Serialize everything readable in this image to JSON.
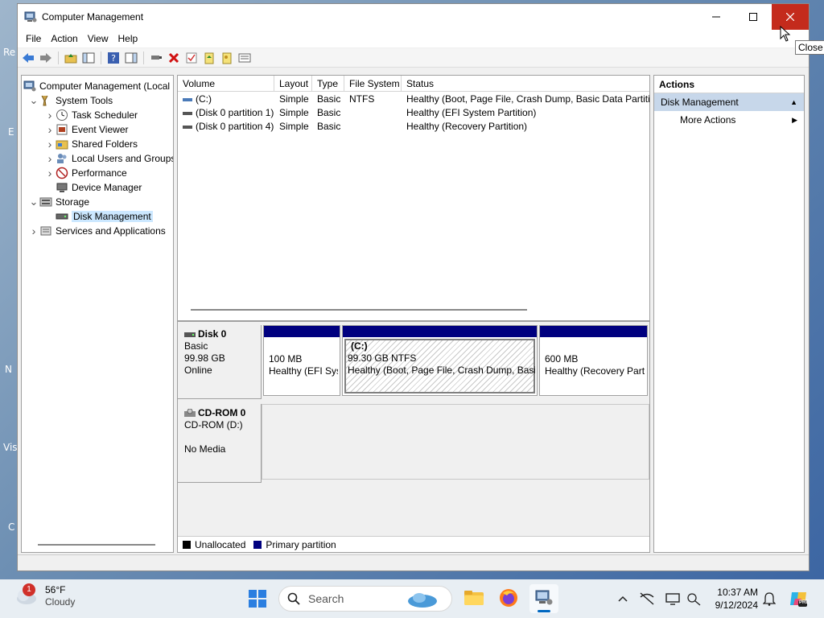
{
  "window": {
    "title": "Computer Management",
    "close_tooltip": "Close"
  },
  "menu": [
    "File",
    "Action",
    "View",
    "Help"
  ],
  "tree": [
    {
      "label": "Computer Management (Local",
      "icon": "computer-management-icon",
      "indent": 0,
      "arrow": ""
    },
    {
      "label": "System Tools",
      "icon": "system-tools-icon",
      "indent": 1,
      "arrow": "expanded"
    },
    {
      "label": "Task Scheduler",
      "icon": "clock-icon",
      "indent": 2,
      "arrow": "collapsed"
    },
    {
      "label": "Event Viewer",
      "icon": "event-viewer-icon",
      "indent": 2,
      "arrow": "collapsed"
    },
    {
      "label": "Shared Folders",
      "icon": "shared-folder-icon",
      "indent": 2,
      "arrow": "collapsed"
    },
    {
      "label": "Local Users and Groups",
      "icon": "users-icon",
      "indent": 2,
      "arrow": "collapsed"
    },
    {
      "label": "Performance",
      "icon": "performance-icon",
      "indent": 2,
      "arrow": "collapsed"
    },
    {
      "label": "Device Manager",
      "icon": "device-manager-icon",
      "indent": 2,
      "arrow": ""
    },
    {
      "label": "Storage",
      "icon": "storage-icon",
      "indent": 1,
      "arrow": "expanded"
    },
    {
      "label": "Disk Management",
      "icon": "disk-icon",
      "indent": 2,
      "arrow": "",
      "selected": true
    },
    {
      "label": "Services and Applications",
      "icon": "services-icon",
      "indent": 1,
      "arrow": "collapsed"
    }
  ],
  "volume_list": {
    "columns": [
      "Volume",
      "Layout",
      "Type",
      "File System",
      "Status"
    ],
    "rows": [
      {
        "volume": "(C:)",
        "layout": "Simple",
        "type": "Basic",
        "fs": "NTFS",
        "status": "Healthy (Boot, Page File, Crash Dump, Basic Data Partition)"
      },
      {
        "volume": "(Disk 0 partition 1)",
        "layout": "Simple",
        "type": "Basic",
        "fs": "",
        "status": "Healthy (EFI System Partition)"
      },
      {
        "volume": "(Disk 0 partition 4)",
        "layout": "Simple",
        "type": "Basic",
        "fs": "",
        "status": "Healthy (Recovery Partition)"
      }
    ]
  },
  "disks": {
    "disk0": {
      "name": "Disk 0",
      "type": "Basic",
      "size": "99.98 GB",
      "state": "Online",
      "partitions": [
        {
          "title": "",
          "size": "100 MB",
          "status": "Healthy (EFI Sys"
        },
        {
          "title": "(C:)",
          "size": "99.30 GB NTFS",
          "status": "Healthy (Boot, Page File, Crash Dump, Basic"
        },
        {
          "title": "",
          "size": "600 MB",
          "status": "Healthy (Recovery Part"
        }
      ]
    },
    "cdrom0": {
      "name": "CD-ROM 0",
      "drive": "CD-ROM (D:)",
      "media": "No Media"
    }
  },
  "legend": [
    {
      "label": "Unallocated",
      "color": "#000000"
    },
    {
      "label": "Primary partition",
      "color": "#00007f"
    }
  ],
  "actions": {
    "header": "Actions",
    "section": "Disk Management",
    "items": [
      "More Actions"
    ]
  },
  "taskbar": {
    "weather_temp": "56°F",
    "weather_desc": "Cloudy",
    "weather_badge": "1",
    "search_placeholder": "Search",
    "time": "10:37 AM",
    "date": "9/12/2024"
  },
  "desktop_fragments": [
    "Re",
    "E",
    "N",
    "Vis",
    "C"
  ]
}
